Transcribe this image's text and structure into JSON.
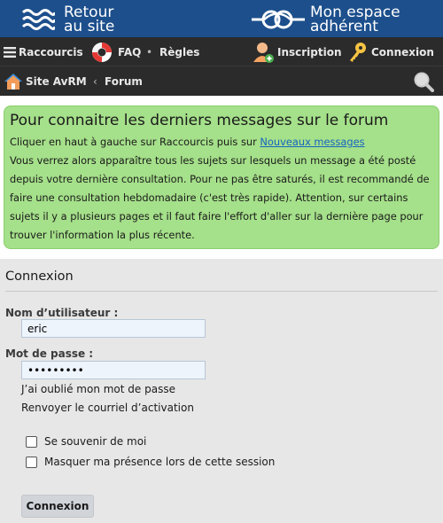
{
  "header": {
    "home_line1": "Retour",
    "home_line2": "au site",
    "space_line1": "Mon espace",
    "space_line2": "adhérent"
  },
  "nav": {
    "shortcuts": "Raccourcis",
    "faq": "FAQ",
    "rules": "Règles",
    "register": "Inscription",
    "login": "Connexion",
    "separator": "•"
  },
  "breadcrumb": {
    "site": "Site AvRM",
    "separator": "‹",
    "forum": "Forum"
  },
  "notice": {
    "title": "Pour connaitre les derniers messages sur le forum",
    "line1_text": "Cliquer en haut à gauche sur Raccourcis puis sur ",
    "line1_link": "Nouveaux messages",
    "body": "Vous verrez alors apparaître tous les sujets sur lesquels un message a été posté depuis votre dernière consultation. Pour ne pas être saturés, il est recommandé de faire une consultation hebdomadaire (c'est très rapide). Attention, sur certains sujets il y a plusieurs pages et il faut faire l'effort d'aller sur la dernière page pour trouver l'information la plus récente."
  },
  "login": {
    "title": "Connexion",
    "username_label": "Nom d’utilisateur :",
    "username_value": "eric",
    "password_label": "Mot de passe :",
    "password_value": "•••••••••",
    "forgot": "J’ai oublié mon mot de passe",
    "resend": "Renvoyer le courriel d’activation",
    "remember": "Se souvenir de moi",
    "hide_presence": "Masquer ma présence lors de cette session",
    "submit": "Connexion"
  },
  "colors": {
    "header_blue": "#1d4f8c",
    "nav_dark": "#2b2b2b",
    "notice_green": "#a5e08a",
    "link_blue": "#1565c0"
  }
}
